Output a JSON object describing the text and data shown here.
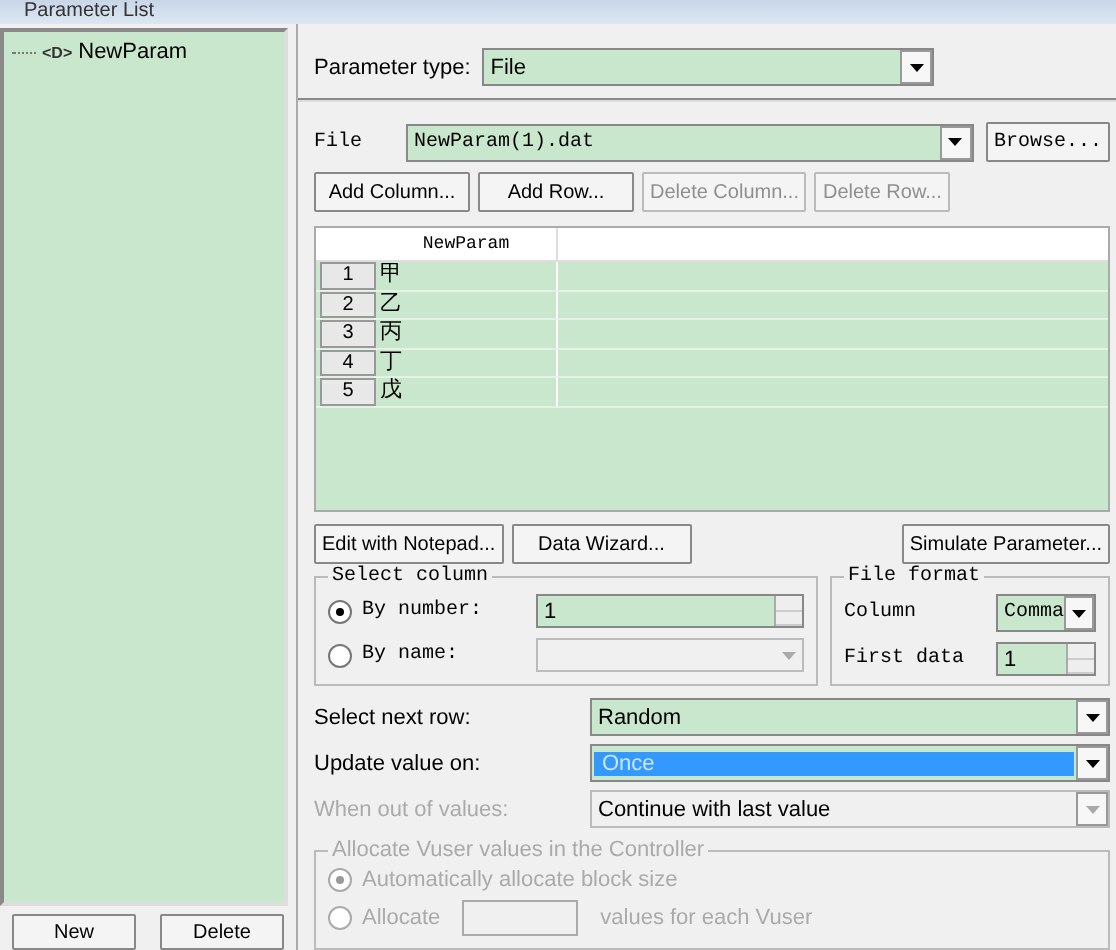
{
  "window": {
    "title": "Parameter List"
  },
  "tree": {
    "items": [
      {
        "badge": "<D>",
        "label": "NewParam"
      }
    ]
  },
  "left_buttons": [
    {
      "label": "New"
    },
    {
      "label": "Delete"
    }
  ],
  "parameter_type": {
    "label": "Parameter type:",
    "value": "File"
  },
  "file": {
    "label": "File",
    "value": "NewParam(1).dat",
    "browse": "Browse..."
  },
  "table_buttons": [
    {
      "label": "Add Column...",
      "disabled": false
    },
    {
      "label": "Add Row...",
      "disabled": false
    },
    {
      "label": "Delete Column...",
      "disabled": true
    },
    {
      "label": "Delete Row...",
      "disabled": true
    }
  ],
  "table": {
    "columns": [
      "NewParam"
    ],
    "rows": [
      {
        "index": "1",
        "cells": [
          "甲"
        ]
      },
      {
        "index": "2",
        "cells": [
          "乙"
        ]
      },
      {
        "index": "3",
        "cells": [
          "丙"
        ]
      },
      {
        "index": "4",
        "cells": [
          "丁"
        ]
      },
      {
        "index": "5",
        "cells": [
          "戊"
        ]
      }
    ]
  },
  "tool_buttons": [
    {
      "label": "Edit with Notepad..."
    },
    {
      "label": "Data Wizard..."
    },
    {
      "label": "Simulate Parameter..."
    }
  ],
  "select_column": {
    "title": "Select column",
    "options": [
      {
        "label": "By number:",
        "selected": true,
        "value": "1",
        "disabled": false
      },
      {
        "label": "By name:",
        "selected": false,
        "disabled": true
      }
    ]
  },
  "file_format": {
    "title": "File format",
    "column": {
      "label": "Column",
      "value": "Comma"
    },
    "first_data": {
      "label": "First data",
      "value": "1"
    }
  },
  "settings": [
    {
      "label": "Select next row:",
      "value": "Random",
      "focused": false,
      "disabled": false
    },
    {
      "label": "Update value on:",
      "value": "Once",
      "focused": true,
      "disabled": false
    },
    {
      "label": "When out of values:",
      "value": "Continue with last value",
      "focused": false,
      "disabled": true
    }
  ],
  "allocate": {
    "title": "Allocate Vuser values in the Controller",
    "disabled": true,
    "options": [
      {
        "label": "Automatically allocate block size",
        "selected": true
      },
      {
        "label": "Allocate",
        "suffix": "values for each Vuser",
        "selected": false
      }
    ]
  }
}
